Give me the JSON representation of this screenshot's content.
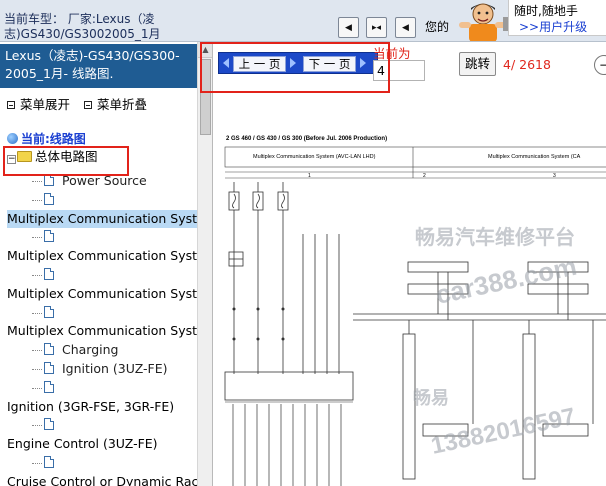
{
  "header": {
    "car_info_line1": "当前车型： 厂家:Lexus（凌",
    "car_info_line2": "志)GS430/GS3002005_1月",
    "top_message": "您的",
    "ad_line1": "随时,随地手",
    "ad_line2": ">>用户升级"
  },
  "sidebar": {
    "doc_title": "Lexus（凌志)-GS430/GS300-2005_1月- 线路图.",
    "expand_label": "菜单展开",
    "collapse_label": "菜单折叠",
    "current_route": "当前:线路图",
    "root_label": "总体电路图",
    "items": [
      {
        "label": "Power Source",
        "indent": 2
      },
      {
        "label": "",
        "indent": 2
      },
      {
        "label": "Multiplex Communication Syst",
        "indent": 0,
        "selected": true
      },
      {
        "label": "",
        "indent": 2
      },
      {
        "label": "Multiplex Communication Syst",
        "indent": 0
      },
      {
        "label": "",
        "indent": 2
      },
      {
        "label": "Multiplex Communication Syst",
        "indent": 0
      },
      {
        "label": "",
        "indent": 2
      },
      {
        "label": "Multiplex Communication Syst",
        "indent": 0
      },
      {
        "label": "Charging",
        "indent": 2
      },
      {
        "label": "Ignition (3UZ-FE)",
        "indent": 2
      },
      {
        "label": "",
        "indent": 2
      },
      {
        "label": "Ignition (3GR-FSE, 3GR-FE)",
        "indent": 0
      },
      {
        "label": "",
        "indent": 2
      },
      {
        "label": "Engine Control (3UZ-FE)",
        "indent": 0
      },
      {
        "label": "",
        "indent": 2
      },
      {
        "label": "Cruise Control or Dynamic Rac",
        "indent": 0
      }
    ]
  },
  "viewer": {
    "prev_page": "上 一 页",
    "next_page": "下 一 页",
    "current_label": "当前为",
    "page_value": "4",
    "jump_label": "跳转",
    "page_count": "4/ 2618"
  },
  "diagram": {
    "header": "2  GS 460 / GS 430 / GS 300 (Before Jul.  2006 Production)",
    "system_title_left": "Multiplex Communication System (AVC-LAN LHD)",
    "system_title_right": "Multiplex Communication System (CA",
    "col1": "1",
    "col2": "2",
    "col3": "3",
    "watermark_text": "畅易汽车维修平台",
    "watermark_url": "car388.com",
    "watermark_phone": "13882016597",
    "watermark_small": "畅易"
  },
  "colors": {
    "title_bg": "#1f5c93",
    "link_blue": "#1a3fd1",
    "accent_red": "#e2231a",
    "pager_blue": "#1c49c8"
  }
}
